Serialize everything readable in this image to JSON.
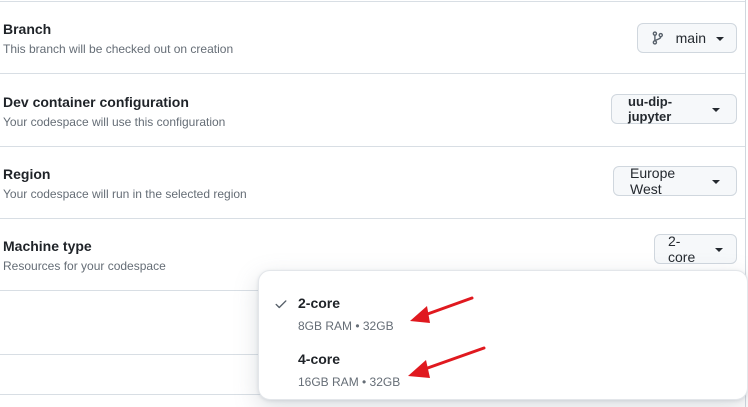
{
  "rows": {
    "branch": {
      "title": "Branch",
      "description": "This branch will be checked out on creation",
      "button_label": "main"
    },
    "devcontainer": {
      "title": "Dev container configuration",
      "description": "Your codespace will use this configuration",
      "button_label": "uu-dip-jupyter"
    },
    "region": {
      "title": "Region",
      "description": "Your codespace will run in the selected region",
      "button_label": "Europe West"
    },
    "machine": {
      "title": "Machine type",
      "description": "Resources for your codespace",
      "button_label": "2-core"
    }
  },
  "machine_menu": {
    "options": [
      {
        "name": "2-core",
        "spec": "8GB RAM • 32GB",
        "selected": true
      },
      {
        "name": "4-core",
        "spec": "16GB RAM • 32GB",
        "selected": false
      }
    ]
  },
  "colors": {
    "annotation_arrow": "#e0191f",
    "border": "#d0d7de",
    "muted_text": "#656d76"
  },
  "icons": {
    "branch_icon": "git-branch-icon",
    "caret": "triangle-down-icon",
    "check": "check-icon",
    "annotation": "red-arrow-annotation"
  }
}
